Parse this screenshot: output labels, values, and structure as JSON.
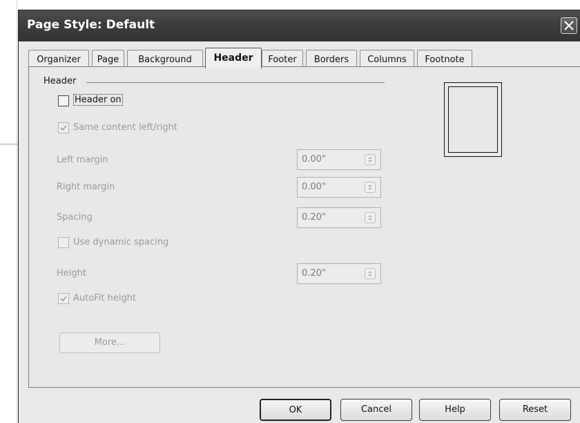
{
  "window": {
    "title": "Page Style: Default"
  },
  "tabs": [
    {
      "label": "Organizer"
    },
    {
      "label": "Page"
    },
    {
      "label": "Background"
    },
    {
      "label": "Header"
    },
    {
      "label": "Footer"
    },
    {
      "label": "Borders"
    },
    {
      "label": "Columns"
    },
    {
      "label": "Footnote"
    }
  ],
  "active_tab": "Header",
  "header_group": {
    "label": "Header",
    "header_on": {
      "label": "Header on",
      "checked": false
    },
    "same_content": {
      "label": "Same content left/right",
      "checked": true
    },
    "left_margin": {
      "label": "Left margin",
      "value": "0.00\""
    },
    "right_margin": {
      "label": "Right margin",
      "value": "0.00\""
    },
    "spacing": {
      "label": "Spacing",
      "value": "0.20\""
    },
    "dynamic_spacing": {
      "label": "Use dynamic spacing",
      "checked": false
    },
    "height": {
      "label": "Height",
      "value": "0.20\""
    },
    "autofit": {
      "label": "AutoFit height",
      "checked": true
    },
    "more_button": "More..."
  },
  "buttons": {
    "ok": "OK",
    "cancel": "Cancel",
    "help": "Help",
    "reset": "Reset"
  },
  "icons": {
    "close": "close-icon",
    "spin": "spin-arrows-icon",
    "check": "checkmark-icon"
  }
}
